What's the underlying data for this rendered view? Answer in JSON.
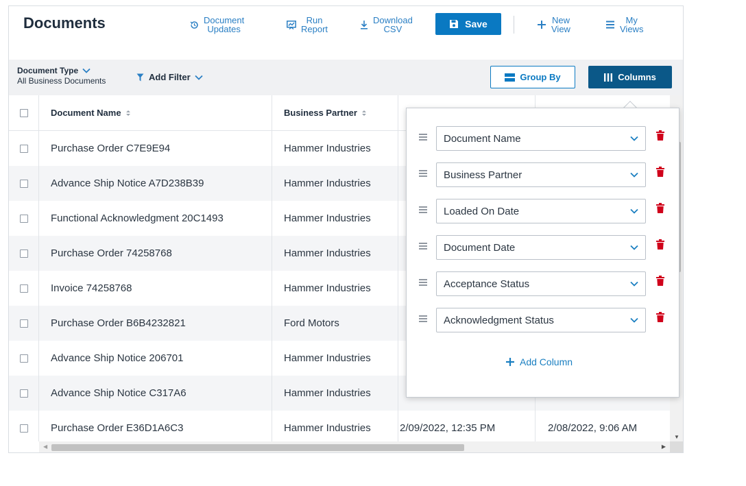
{
  "toolbar": {
    "title": "Documents",
    "document_updates": [
      "Document",
      "Updates"
    ],
    "run_report": [
      "Run",
      "Report"
    ],
    "download_csv": [
      "Download",
      "CSV"
    ],
    "save": "Save",
    "new_view": [
      "New",
      "View"
    ],
    "my_views": [
      "My",
      "Views"
    ]
  },
  "filters": {
    "document_type_label": "Document Type",
    "document_type_value": "All Business Documents",
    "add_filter": "Add Filter",
    "group_by": "Group By",
    "columns": "Columns"
  },
  "table": {
    "headers": {
      "document_name": "Document Name",
      "business_partner": "Business Partner"
    },
    "rows": [
      {
        "name": "Purchase Order C7E9E94",
        "partner": "Hammer Industries",
        "loaded": "",
        "date": ""
      },
      {
        "name": "Advance Ship Notice A7D238B39",
        "partner": "Hammer Industries",
        "loaded": "",
        "date": ""
      },
      {
        "name": "Functional Acknowledgment 20C1493",
        "partner": "Hammer Industries",
        "loaded": "",
        "date": ""
      },
      {
        "name": "Purchase Order 74258768",
        "partner": "Hammer Industries",
        "loaded": "",
        "date": ""
      },
      {
        "name": "Invoice 74258768",
        "partner": "Hammer Industries",
        "loaded": "",
        "date": ""
      },
      {
        "name": "Purchase Order B6B4232821",
        "partner": "Ford Motors",
        "loaded": "",
        "date": ""
      },
      {
        "name": "Advance Ship Notice 206701",
        "partner": "Hammer Industries",
        "loaded": "",
        "date": ""
      },
      {
        "name": "Advance Ship Notice C317A6",
        "partner": "Hammer Industries",
        "loaded": "",
        "date": ""
      },
      {
        "name": "Purchase Order E36D1A6C3",
        "partner": "Hammer Industries",
        "loaded": "2/09/2022, 12:35 PM",
        "date": "2/08/2022, 9:06 AM"
      }
    ]
  },
  "columns_panel": {
    "items": [
      "Document Name",
      "Business Partner",
      "Loaded On Date",
      "Document Date",
      "Acceptance Status",
      "Acknowledgment Status"
    ],
    "add_column": "Add Column"
  },
  "colors": {
    "accent": "#0a79c2",
    "columns_button": "#0b5888",
    "delete": "#d0021b",
    "toolbar_text": "#2a7fc4"
  },
  "icons": {
    "document_updates": "history-icon",
    "run_report": "report-icon",
    "download_csv": "download-icon",
    "save": "floppy-disk-icon",
    "new_view": "plus-icon",
    "my_views": "list-icon",
    "add_filter": "filter-icon",
    "group_by": "group-icon",
    "columns": "columns-icon",
    "drag": "drag-handle-icon",
    "delete": "trash-icon"
  }
}
